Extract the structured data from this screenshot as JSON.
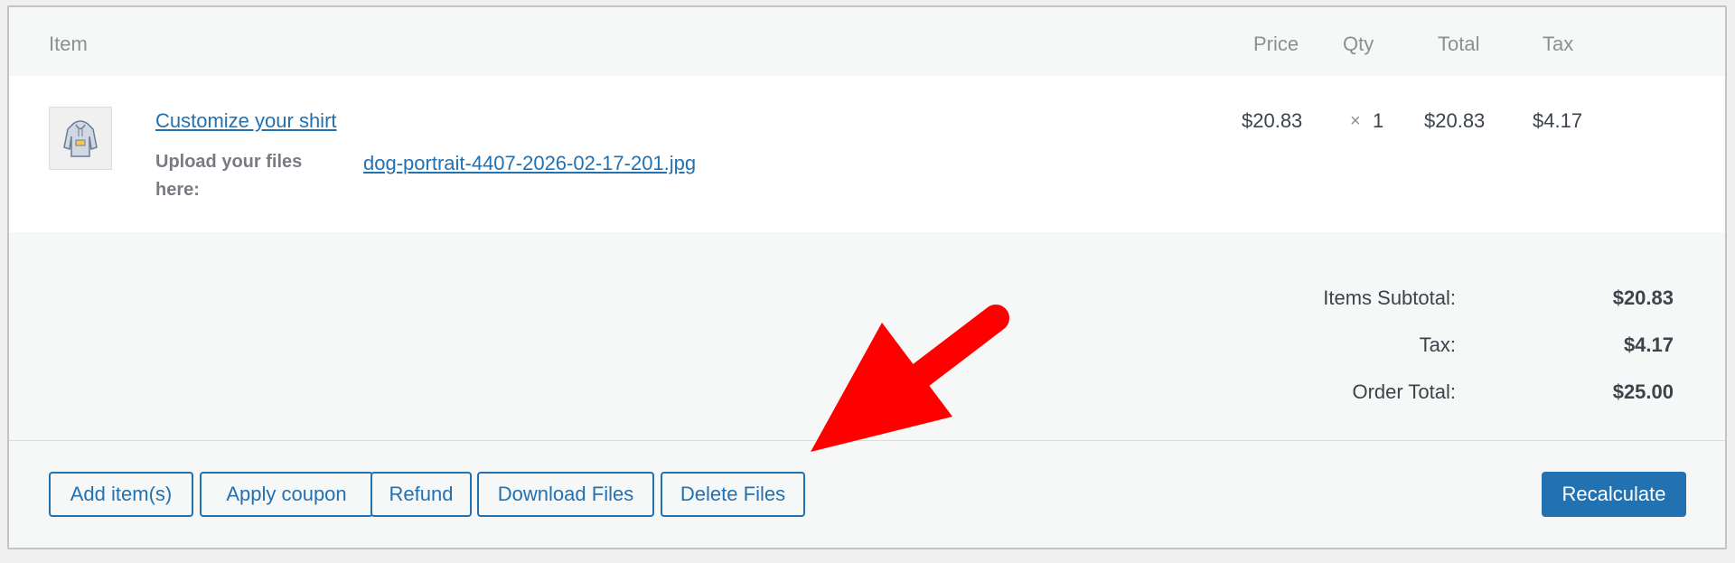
{
  "table": {
    "headers": {
      "item": "Item",
      "price": "Price",
      "qty": "Qty",
      "total": "Total",
      "tax": "Tax"
    }
  },
  "line_item": {
    "thumbnail_icon": "hoodie-thumbnail",
    "name": "Customize your shirt",
    "meta_label": "Upload your files here:",
    "meta_value": "dog-portrait-4407-2026-02-17-201.jpg",
    "price": "$20.83",
    "qty_symbol": "×",
    "qty": "1",
    "total": "$20.83",
    "tax": "$4.17"
  },
  "totals": {
    "subtotal_label": "Items Subtotal:",
    "subtotal_value": "$20.83",
    "tax_label": "Tax:",
    "tax_value": "$4.17",
    "order_total_label": "Order Total:",
    "order_total_value": "$25.00"
  },
  "actions": {
    "add_items": "Add item(s)",
    "apply_coupon": "Apply coupon",
    "refund": "Refund",
    "download_files": "Download Files",
    "delete_files": "Delete Files",
    "recalculate": "Recalculate"
  },
  "annotation": {
    "arrow_color": "#ff0000",
    "arrow_icon": "red-pointer-arrow"
  },
  "colors": {
    "accent": "#2271b1",
    "panel_bg": "#f6f7f7",
    "row_bg": "#ffffff"
  }
}
